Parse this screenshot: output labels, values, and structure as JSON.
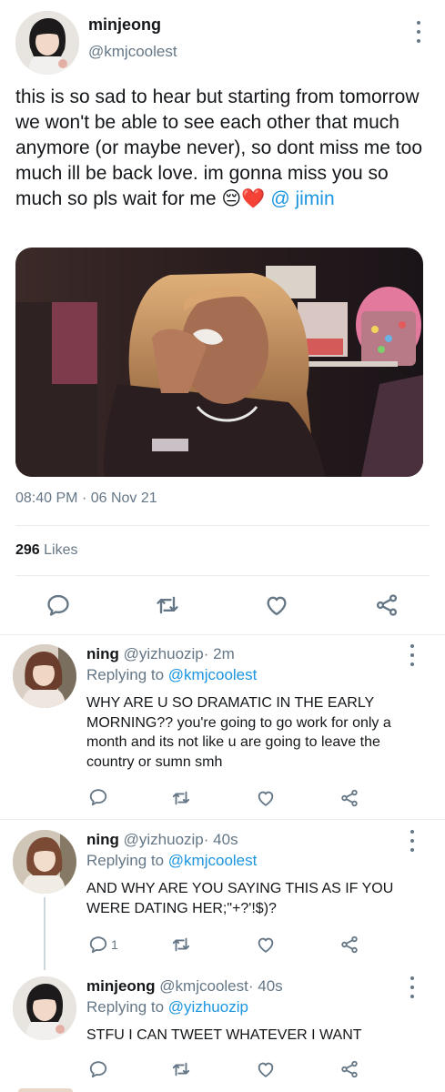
{
  "main_tweet": {
    "name": "minjeong",
    "handle": "@kmjcoolest",
    "text": "this is so sad to hear but starting from tomorrow we won't be able to see each other that much anymore (or maybe never), so dont miss me too much ill be back love. im gonna miss you so much so pls wait for me",
    "emojis": "😔❤️",
    "mention": "@ jimin",
    "time": "08:40 PM",
    "separator": "·",
    "date": "06 Nov 21",
    "likes_count": "296",
    "likes_label": "Likes"
  },
  "replies": [
    {
      "name": "ning",
      "handle": "@yizhuozip",
      "sep": "·",
      "time": "2m",
      "replying_label": "Replying to",
      "replying_to": "@kmjcoolest",
      "text": "WHY ARE U SO DRAMATIC IN THE EARLY MORNING?? you're going to go work for only a month and its not like u are going to leave the country or sumn smh",
      "reply_count": ""
    },
    {
      "name": "ning",
      "handle": "@yizhuozip",
      "sep": "·",
      "time": "40s",
      "replying_label": "Replying to",
      "replying_to": "@kmjcoolest",
      "text": "AND WHY ARE YOU SAYING THIS AS IF YOU WERE DATING HER;\"+?'!$)?",
      "reply_count": "1"
    },
    {
      "name": "minjeong",
      "handle": "@kmjcoolest",
      "sep": "·",
      "time": "40s",
      "replying_label": "Replying to",
      "replying_to": "@yizhuozip",
      "text": "STFU I CAN TWEET WHATEVER I WANT",
      "reply_count": ""
    }
  ],
  "icons": [
    "reply-icon",
    "retweet-icon",
    "like-icon",
    "share-icon",
    "more-icon"
  ],
  "colors": {
    "link": "#1b95e0",
    "muted": "#657786",
    "text": "#14171a",
    "divider": "#e6ecf0"
  }
}
